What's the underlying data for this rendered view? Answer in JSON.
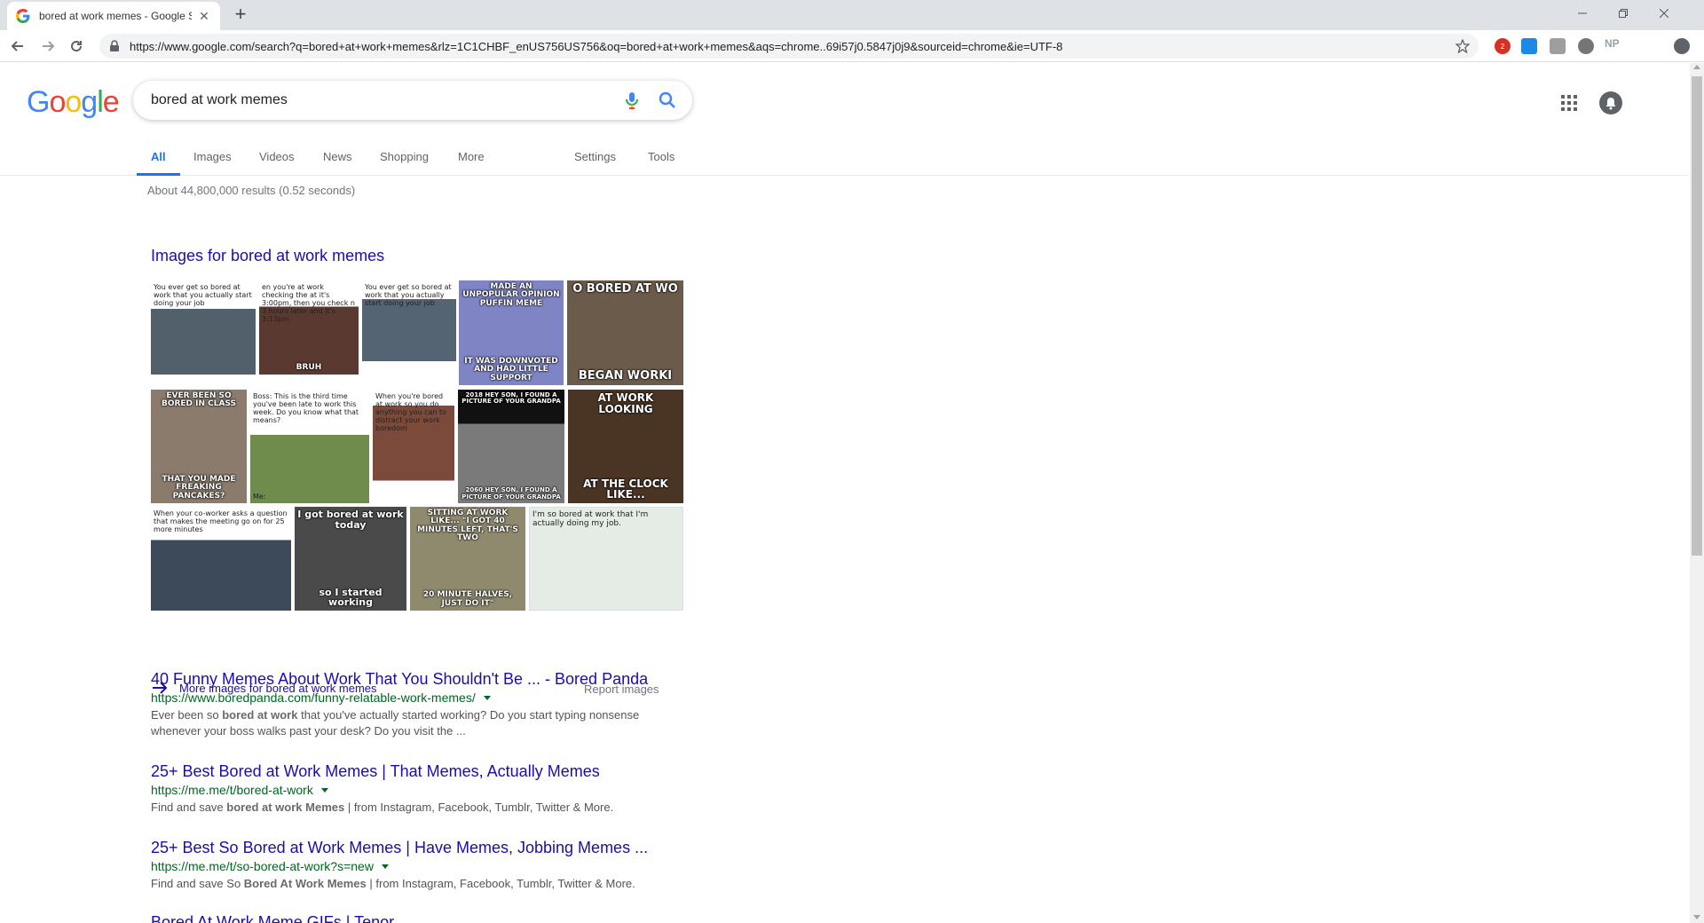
{
  "browser": {
    "tab_title": "bored at work memes - Google Search",
    "url": "https://www.google.com/search?q=bored+at+work+memes&rlz=1C1CHBF_enUS756US756&oq=bored+at+work+memes&aqs=chrome..69i57j0.5847j0j9&sourceid=chrome&ie=UTF-8",
    "extensions": [
      "adblock-icon",
      "calendar-icon",
      "grey-extension-icon",
      "globe-icon"
    ],
    "ext_np_label": "NP",
    "adblock_badge": "2"
  },
  "search": {
    "query": "bored at work memes",
    "tabs": [
      "All",
      "Images",
      "Videos",
      "News",
      "Shopping",
      "More",
      "Settings",
      "Tools"
    ],
    "stats": "About 44,800,000 results (0.52 seconds)"
  },
  "images": {
    "heading": "Images for bored at work memes",
    "more_link": "More images for bored at work memes",
    "report": "Report images",
    "thumbs": [
      {
        "top": "You ever get so bored at work that you actually start doing your job",
        "bottom": ""
      },
      {
        "top": "en you're at work checking the at it's 3:00pm, then you check n 3 hours later and it's 3:13pm",
        "bottom": "BRUH"
      },
      {
        "top": "You ever get so bored at work that you actually start doing your job",
        "bottom": ""
      },
      {
        "top": "MADE AN UNPOPULAR OPINION PUFFIN MEME",
        "bottom": "IT WAS DOWNVOTED AND HAD LITTLE SUPPORT"
      },
      {
        "top": "O BORED AT WO",
        "bottom": "BEGAN WORKI"
      },
      {
        "top": "EVER BEEN SO BORED IN CLASS",
        "bottom": "THAT YOU MADE FREAKING PANCAKES?"
      },
      {
        "top": "Boss: This is the third time you've been late to work this week. Do you know what that means?",
        "bottom": "Me:"
      },
      {
        "top": "When you're bored at work so you do anything you can to distract your work boredom",
        "bottom": ""
      },
      {
        "top": "2018 HEY SON, I FOUND A PICTURE OF YOUR GRANDPA",
        "bottom": "2060 HEY SON, I FOUND A PICTURE OF YOUR GRANDPA"
      },
      {
        "top": "AT WORK LOOKING",
        "bottom": "AT THE CLOCK LIKE..."
      },
      {
        "top": "When your co-worker asks a question that makes the meeting go on for 25 more minutes",
        "bottom": ""
      },
      {
        "top": "I got bored at work today",
        "bottom": "so I started working"
      },
      {
        "top": "SITTING AT WORK LIKE... \"I GOT 40 MINUTES LEFT, THAT'S TWO",
        "bottom": "20 MINUTE HALVES, JUST DO IT\""
      },
      {
        "top": "I'm so bored at work that I'm actually doing my job.",
        "bottom": ""
      }
    ]
  },
  "results": [
    {
      "title": "40 Funny Memes About Work That You Shouldn't Be ... - Bored Panda",
      "url": "https://www.boredpanda.com/funny-relatable-work-memes/",
      "snippet_pre": "Ever been so ",
      "snippet_bold": "bored at work",
      "snippet_post": " that you've actually started working? Do you start typing nonsense whenever your boss walks past your desk? Do you visit the ..."
    },
    {
      "title": "25+ Best Bored at Work Memes | That Memes, Actually Memes",
      "url": "https://me.me/t/bored-at-work",
      "snippet_pre": "Find and save ",
      "snippet_bold": "bored at work Memes",
      "snippet_post": " | from Instagram, Facebook, Tumblr, Twitter & More."
    },
    {
      "title": "25+ Best So Bored at Work Memes | Have Memes, Jobbing Memes ...",
      "url": "https://me.me/t/so-bored-at-work?s=new",
      "snippet_pre": "Find and save So ",
      "snippet_bold": "Bored At Work Memes",
      "snippet_post": " | from Instagram, Facebook, Tumblr, Twitter & More."
    },
    {
      "title": "Bored At Work Meme GIFs | Tenor",
      "url": "",
      "snippet_pre": "",
      "snippet_bold": "",
      "snippet_post": ""
    }
  ],
  "colors": {
    "link": "#1a0dab",
    "url_green": "#006621",
    "accent_blue": "#1a73e8"
  }
}
